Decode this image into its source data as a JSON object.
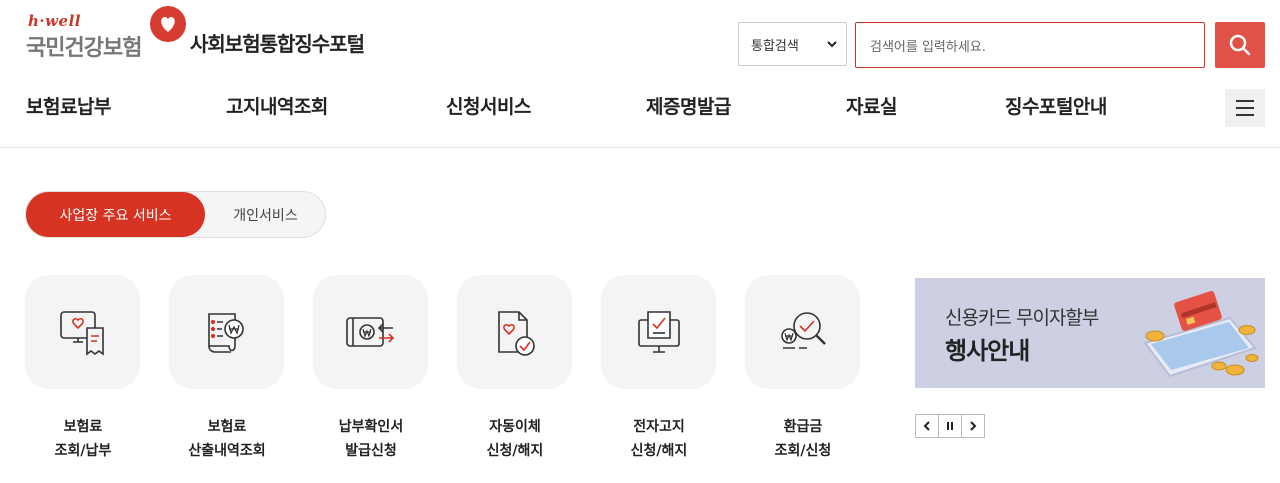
{
  "header": {
    "logo_en": "h·well",
    "logo_kr": "국민건강보험",
    "portal_title": "사회보험통합징수포털"
  },
  "search": {
    "scope_selected": "통합검색",
    "placeholder": "검색어를 입력하세요.",
    "button_icon": "search-icon"
  },
  "gnb": {
    "items": [
      "보험료납부",
      "고지내역조회",
      "신청서비스",
      "제증명발급",
      "자료실",
      "징수포털안내"
    ],
    "menu_icon": "hamburger-icon"
  },
  "tabs": {
    "active": "사업장 주요 서비스",
    "inactive": "개인서비스"
  },
  "services": [
    {
      "line1": "보험료",
      "line2": "조회/납부",
      "icon": "monitor-receipt-icon"
    },
    {
      "line1": "보험료",
      "line2": "산출내역조회",
      "icon": "document-won-icon"
    },
    {
      "line1": "납부확인서",
      "line2": "발급신청",
      "icon": "payment-transfer-icon"
    },
    {
      "line1": "자동이체",
      "line2": "신청/해지",
      "icon": "document-check-icon"
    },
    {
      "line1": "전자고지",
      "line2": "신청/해지",
      "icon": "computer-notice-icon"
    },
    {
      "line1": "환급금",
      "line2": "조회/신청",
      "icon": "refund-search-icon"
    }
  ],
  "banner": {
    "line1": "신용카드 무이자할부",
    "line2": "행사안내",
    "icon": "phone-credit-card-coins-icon"
  },
  "colors": {
    "accent": "#d63323",
    "search_border": "#c8372c",
    "banner_bg": "#cdd0e3"
  }
}
